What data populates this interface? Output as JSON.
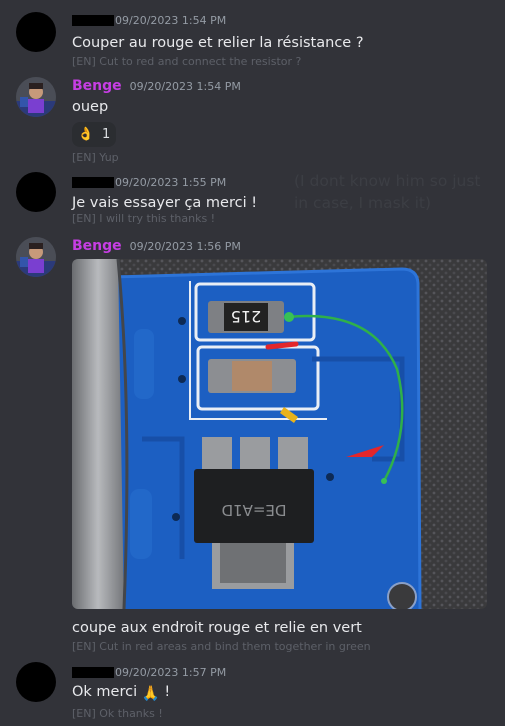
{
  "messages": [
    {
      "user": "",
      "timestamp": "09/20/2023 1:54 PM",
      "text": "Couper au rouge et relier la résistance ?",
      "translation": "[EN] Cut to red and connect the resistor ?"
    },
    {
      "user": "Benge",
      "timestamp": "09/20/2023 1:54 PM",
      "text": "ouep",
      "reaction": {
        "emoji": "👌",
        "count": "1"
      },
      "translation": "[EN] Yup"
    },
    {
      "user": "",
      "timestamp": "09/20/2023 1:55 PM",
      "text": "Je vais essayer ça merci !",
      "translation": "[EN] I will try this thanks !"
    },
    {
      "user": "Benge",
      "timestamp": "09/20/2023 1:56 PM",
      "attachment": {
        "component_label": "215",
        "chip_label": "DE=A1D"
      },
      "text": "coupe aux endroit rouge et relie en vert",
      "translation": "[EN] Cut in red areas and bind them together in green"
    },
    {
      "user": "",
      "timestamp": "09/20/2023 1:57 PM",
      "text": "Ok merci",
      "emoji": "🙏",
      "text_suffix": " !",
      "translation": "[EN] Ok thanks !"
    }
  ],
  "overlay_note": "(I dont know him so just in case, I mask it)",
  "colors": {
    "background": "#323339",
    "username": "#c63ee3",
    "timestamp": "#949ba4",
    "translation": "#5d6068",
    "pcb_blue": "#1c5fc2"
  }
}
